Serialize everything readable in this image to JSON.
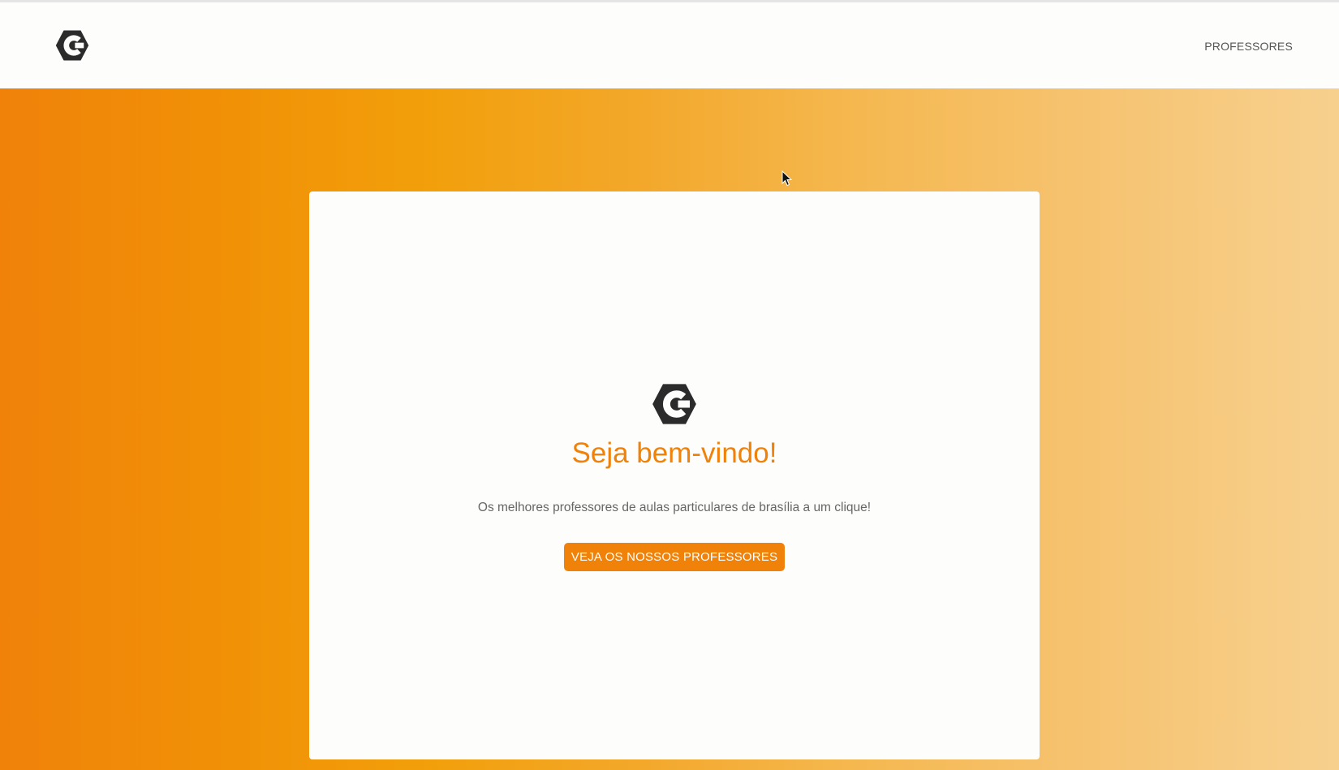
{
  "header": {
    "logo_icon": "hexagon-c-logo-icon",
    "nav": [
      {
        "label": "PROFESSORES"
      }
    ]
  },
  "hero": {
    "gradient_colors": [
      "#f0820a",
      "#f29f0b",
      "#f7d08e"
    ],
    "card": {
      "logo_icon": "hexagon-c-logo-icon",
      "title": "Seja bem-vindo!",
      "subtitle": "Os melhores professores de aulas particulares de brasília a um clique!",
      "cta_label": "VEJA OS NOSSOS PROFESSORES"
    }
  },
  "colors": {
    "accent": "#f0820a",
    "logo": "#2b2b2b",
    "text_muted": "#666666"
  }
}
